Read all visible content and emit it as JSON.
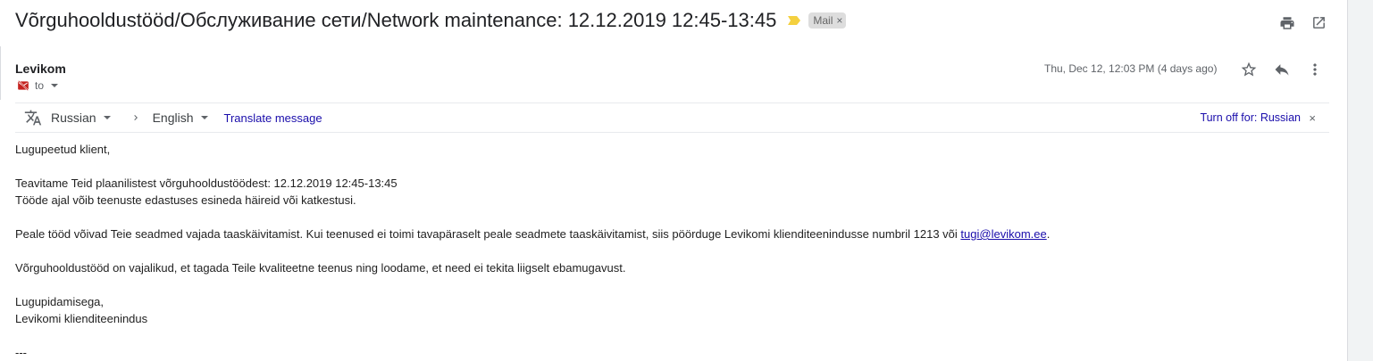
{
  "subject": "Võrguhooldustööd/Обслуживание сети/Network maintenance: 12.12.2019 12:45-13:45",
  "label_chip": "Mail",
  "label_remove": "×",
  "sender": "Levikom",
  "recipient_prefix": "to",
  "date": "Thu, Dec 12, 12:03 PM (4 days ago)",
  "translate": {
    "source_lang": "Russian",
    "target_lang": "English",
    "translate_link": "Translate message",
    "turn_off": "Turn off for: Russian",
    "close": "×"
  },
  "body": {
    "greeting": "Lugupeetud klient,",
    "line1": "Teavitame Teid plaanilistest võrguhooldustöödest: 12.12.2019 12:45-13:45",
    "line2": "Tööde ajal võib teenuste edastuses esineda häireid või katkestusi.",
    "para2_text": "Peale tööd võivad Teie seadmed vajada taaskäivitamist. Kui teenused ei toimi tavapäraselt peale seadmete taaskäivitamist, siis pöörduge Levikomi klienditeenindusse numbril 1213 või ",
    "para2_link": "tugi@levikom.ee",
    "para2_end": ".",
    "para3": "Võrguhooldustööd on vajalikud, et tagada Teile kvaliteetne teenus ning loodame, et need ei tekita liigselt ebamugavust.",
    "closing": "Lugupidamisega,",
    "signature": "Levikomi klienditeenindus",
    "separator": "---"
  },
  "colors": {
    "link": "#1a0dab",
    "important_marker": "#f4d03f",
    "unauthenticated_icon": "#c5221f"
  }
}
